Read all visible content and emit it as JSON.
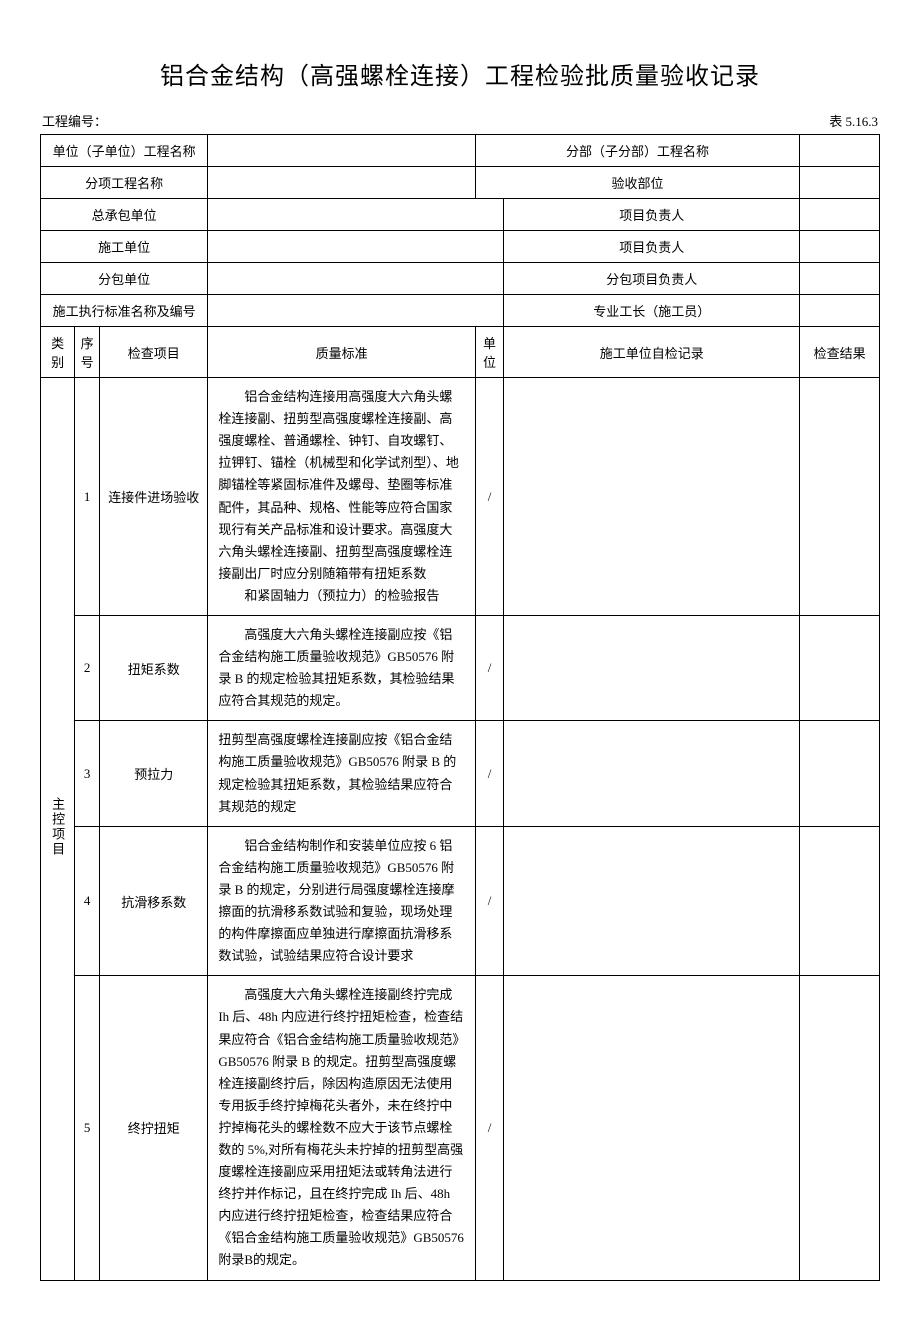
{
  "title": "铝合金结构（高强螺栓连接）工程检验批质量验收记录",
  "header": {
    "project_no_label": "工程编号：",
    "table_no": "表 5.16.3"
  },
  "info_rows": {
    "r1": {
      "l1": "单位（子单位）工程名称",
      "l2": "分部（子分部）工程名称"
    },
    "r2": {
      "l1": "分项工程名称",
      "l2": "验收部位"
    },
    "r3": {
      "l1": "总承包单位",
      "l2": "项目负责人"
    },
    "r4": {
      "l1": "施工单位",
      "l2": "项目负责人"
    },
    "r5": {
      "l1": "分包单位",
      "l2": "分包项目负责人"
    },
    "r6": {
      "l1": "施工执行标准名称及编号",
      "l2": "专业工长（施工员）"
    }
  },
  "columns": {
    "category": "类别",
    "seq": "序号",
    "item": "检查项目",
    "quality": "质量标准",
    "unit": "单位",
    "record": "施工单位自检记录",
    "result": "检查结果"
  },
  "group_label": "主控项目",
  "rows": [
    {
      "seq": "1",
      "item": "连接件进场验收",
      "quality_p1": "铝合金结构连接用高强度大六角头螺栓连接副、扭剪型高强度螺栓连接副、高强度螺栓、普通螺栓、钟钉、自攻螺钉、拉钾钉、锚栓（机械型和化学试剂型）、地脚锚栓等紧固标准件及螺母、垫圈等标准配件，其品种、规格、性能等应符合国家现行有关产品标准和设计要求。高强度大六角头螺栓连接副、扭剪型高强度螺栓连接副出厂时应分别随箱带有扭矩系数",
      "quality_p2": "和紧固轴力（预拉力）的检验报告",
      "unit": "/"
    },
    {
      "seq": "2",
      "item": "扭矩系数",
      "quality_p1": "高强度大六角头螺栓连接副应按《铝合金结构施工质量验收规范》GB50576 附录 B 的规定检验其扭矩系数，其检验结果应符合其规范的规定。",
      "quality_p2": "",
      "unit": "/"
    },
    {
      "seq": "3",
      "item": "预拉力",
      "quality_p1": "扭剪型高强度螺栓连接副应按《铝合金结构施工质量验收规范》GB50576 附录 B 的规定检验其扭矩系数，其检验结果应符合其规范的规定",
      "quality_p2": "",
      "unit": "/"
    },
    {
      "seq": "4",
      "item": "抗滑移系数",
      "quality_p1": "铝合金结构制作和安装单位应按 6 铝合金结构施工质量验收规范》GB50576 附录 B 的规定，分别进行局强度螺栓连接摩擦面的抗滑移系数试验和复验，现场处理的构件摩擦面应单独进行摩擦面抗滑移系数试验，试验结果应符合设计要求",
      "quality_p2": "",
      "unit": "/"
    },
    {
      "seq": "5",
      "item": "终拧扭矩",
      "quality_p1": "高强度大六角头螺栓连接副终拧完成 Ih 后、48h 内应进行终拧扭矩检查，检查结果应符合《铝合金结构施工质量验收规范》GB50576 附录 B 的规定。扭剪型高强度螺栓连接副终拧后，除因构造原因无法使用专用扳手终拧掉梅花头者外，未在终拧中拧掉梅花头的螺栓数不应大于该节点螺栓数的 5%,对所有梅花头未拧掉的扭剪型高强度螺栓连接副应采用扭矩法或转角法进行终拧并作标记，且在终拧完成 Ih 后、48h 内应进行终拧扭矩检查，检查结果应符合《铝合金结构施工质量验收规范》GB50576附录B的规定。",
      "quality_p2": "",
      "unit": "/"
    }
  ]
}
